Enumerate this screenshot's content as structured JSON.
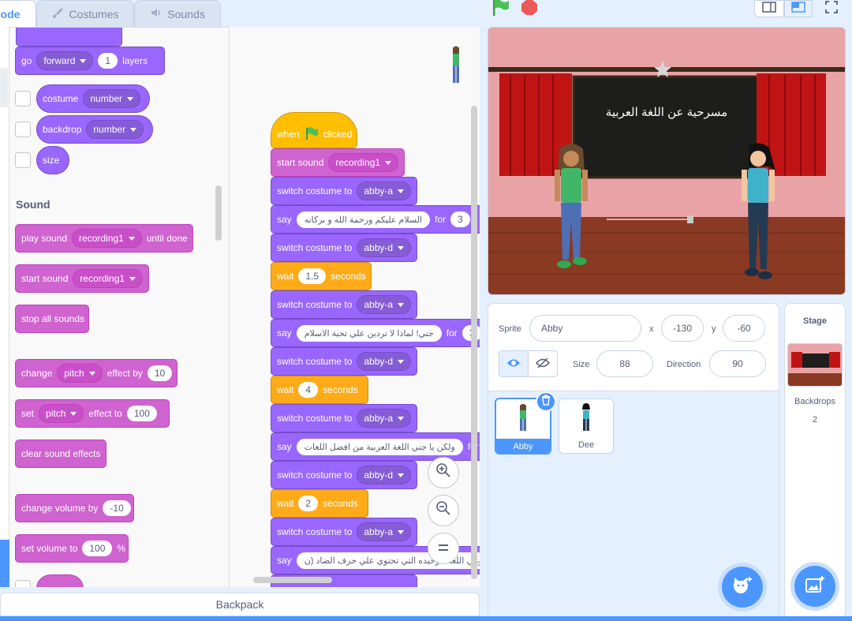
{
  "tabs": {
    "code": "ode",
    "costumes": "Costumes",
    "sounds": "Sounds"
  },
  "palette": {
    "go_label": "go",
    "go_dir": "forward",
    "go_num": "1",
    "go_layers": "layers",
    "costume_label": "costume",
    "costume_opt": "number",
    "backdrop_label": "backdrop",
    "backdrop_opt": "number",
    "size_label": "size",
    "sound_heading": "Sound",
    "play_sound": "play sound",
    "play_sound_opt": "recording1",
    "until_done": "until done",
    "start_sound": "start sound",
    "start_sound_opt": "recording1",
    "stop_all": "stop all sounds",
    "change_label": "change",
    "change_opt": "pitch",
    "effect_by": "effect by",
    "change_val": "10",
    "set_label": "set",
    "set_opt": "pitch",
    "effect_to": "effect to",
    "set_val": "100",
    "clear_effects": "clear sound effects",
    "change_volume": "change volume by",
    "change_volume_val": "-10",
    "set_volume": "set volume to",
    "set_volume_val": "100",
    "percent": "%"
  },
  "script": {
    "when": "when",
    "clicked": "clicked",
    "start_sound": "start sound",
    "start_sound_opt": "recording1",
    "switch_costume": "switch costume to",
    "say": "say",
    "for": "for",
    "wait": "wait",
    "seconds": "seconds",
    "costumes": [
      "abby-a",
      "abby-d",
      "abby-a",
      "abby-d",
      "abby-a",
      "abby-d",
      "abby-a"
    ],
    "say1": "السلام عليكم ورحمة الله و بركاته",
    "say1_for": "3",
    "wait1": "1.5",
    "say2": "جني! لماذا لا تردين علي تحية الاسلام",
    "say2_for": "3",
    "wait2": "4",
    "say3": "ولكن يا جني اللغة العربية من افضل اللغات",
    "wait3": "2",
    "say4": "وهي اللغة الوحيده التي تحتوي علي حرف الضاد (ن"
  },
  "backpack": "Backpack",
  "stage_text": "مسرحية عن اللغة العربية",
  "sprite_info": {
    "sprite_label": "Sprite",
    "sprite_name": "Abby",
    "x_label": "x",
    "x_val": "-130",
    "y_label": "y",
    "y_val": "-60",
    "size_label": "Size",
    "size_val": "88",
    "direction_label": "Direction",
    "direction_val": "90"
  },
  "sprites": [
    {
      "name": "Abby",
      "selected": true
    },
    {
      "name": "Dee",
      "selected": false
    }
  ],
  "stage_panel": {
    "title": "Stage",
    "backdrops_label": "Backdrops",
    "backdrops_count": "2"
  },
  "colors": {
    "accent": "#4c97ff",
    "looks": "#9966ff",
    "sound": "#cf63cf",
    "control": "#ffab19",
    "events": "#ffbf00"
  }
}
